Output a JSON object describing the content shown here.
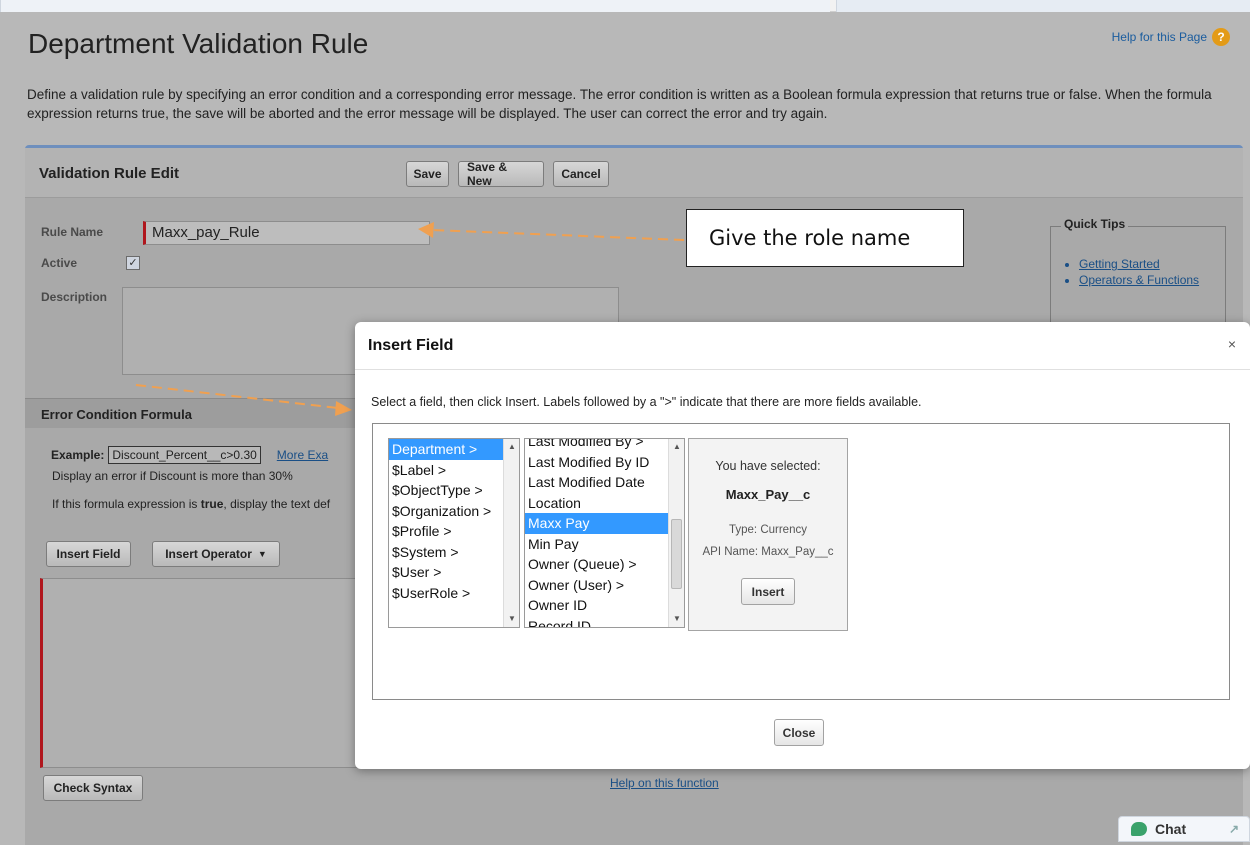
{
  "page": {
    "title": "Department Validation Rule",
    "help_link": "Help for this Page",
    "help_icon": "question-icon",
    "intro": "Define a validation rule by specifying an error condition and a corresponding error message. The error condition is written as a Boolean formula expression that returns true or false. When the formula expression returns true, the save will be aborted and the error message will be displayed. The user can correct the error and try again."
  },
  "edit": {
    "title": "Validation Rule Edit",
    "save": "Save",
    "save_new": "Save & New",
    "cancel": "Cancel",
    "rule_name_label": "Rule Name",
    "rule_name_value": "Maxx_pay_Rule",
    "active_label": "Active",
    "active_checked": true,
    "description_label": "Description",
    "quick_tips_title": "Quick Tips",
    "quick_tips": [
      "Getting Started",
      "Operators & Functions"
    ]
  },
  "formula": {
    "section_title": "Error Condition Formula",
    "example_label": "Example:",
    "example_code": "Discount_Percent__c>0.30",
    "more_examples": "More Exa",
    "display_text": "Display an error if Discount is more than 30%",
    "if_text_pre": "If this formula expression is ",
    "if_text_bold": "true",
    "if_text_post": ", display the text def",
    "insert_field": "Insert Field",
    "insert_operator": "Insert Operator",
    "check_syntax": "Check Syntax",
    "help_function": "Help on this function"
  },
  "callout": {
    "text": "Give the role name"
  },
  "modal": {
    "title": "Insert Field",
    "close_x": "×",
    "description": "Select a field, then click Insert. Labels followed by a \">\" indicate that there are more fields available.",
    "list1": [
      "Department >",
      "$Label >",
      "$ObjectType >",
      "$Organization >",
      "$Profile >",
      "$System >",
      "$User >",
      "$UserRole >"
    ],
    "list1_selected": 0,
    "list2": [
      "Last Modified By >",
      "Last Modified By ID",
      "Last Modified Date",
      "Location",
      "Maxx Pay",
      "Min Pay",
      "Owner (Queue) >",
      "Owner (User) >",
      "Owner ID",
      "Record ID"
    ],
    "list2_selected": 4,
    "selected_heading": "You have selected:",
    "selected_field": "Maxx_Pay__c",
    "selected_type": "Type: Currency",
    "selected_api": "API Name: Maxx_Pay__c",
    "insert": "Insert",
    "close": "Close"
  },
  "chat": {
    "label": "Chat",
    "icon": "chat-bubble-icon",
    "expand_icon": "expand-arrow-icon"
  },
  "colors": {
    "link": "#1a4f86",
    "selection": "#3399ff",
    "required_bar": "#b0161d",
    "annotation_arrow": "#f0a050"
  }
}
